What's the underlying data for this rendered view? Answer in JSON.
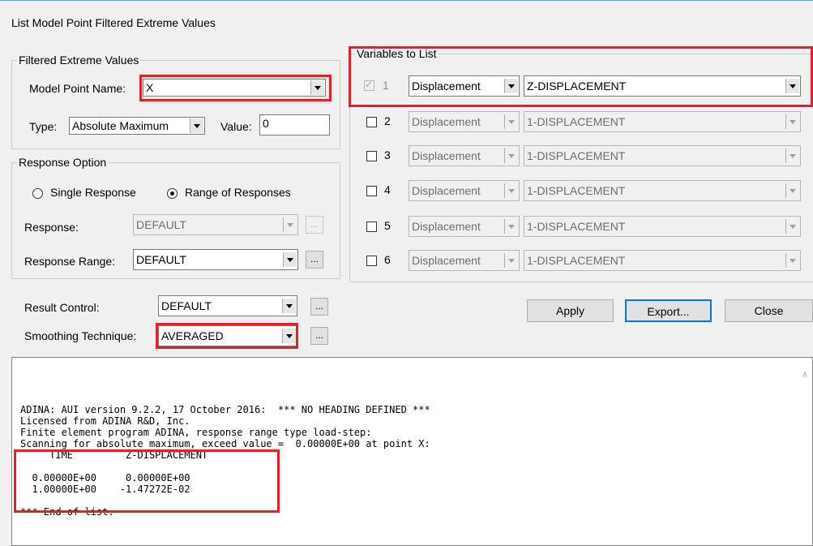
{
  "window": {
    "title": "List Model Point Filtered Extreme Values"
  },
  "filtered": {
    "group_label": "Filtered Extreme Values",
    "model_point_label": "Model Point Name:",
    "model_point_value": "X",
    "type_label": "Type:",
    "type_value": "Absolute Maximum",
    "value_label": "Value:",
    "value_value": "0"
  },
  "response": {
    "group_label": "Response Option",
    "single_label": "Single Response",
    "range_label": "Range of Responses",
    "selected": "Range of Responses",
    "response_label": "Response:",
    "response_value": "DEFAULT",
    "range_field_label": "Response Range:",
    "range_value": "DEFAULT"
  },
  "controls": {
    "result_label": "Result Control:",
    "result_value": "DEFAULT",
    "smoothing_label": "Smoothing Technique:",
    "smoothing_value": "AVERAGED",
    "ellipsis": "..."
  },
  "variables": {
    "group_label": "Variables to List",
    "rows": [
      {
        "num": "1",
        "checked": true,
        "enabled": false,
        "type": "Displacement",
        "variable": "Z-DISPLACEMENT"
      },
      {
        "num": "2",
        "checked": false,
        "enabled": true,
        "type": "Displacement",
        "variable": "1-DISPLACEMENT"
      },
      {
        "num": "3",
        "checked": false,
        "enabled": true,
        "type": "Displacement",
        "variable": "1-DISPLACEMENT"
      },
      {
        "num": "4",
        "checked": false,
        "enabled": true,
        "type": "Displacement",
        "variable": "1-DISPLACEMENT"
      },
      {
        "num": "5",
        "checked": false,
        "enabled": true,
        "type": "Displacement",
        "variable": "1-DISPLACEMENT"
      },
      {
        "num": "6",
        "checked": false,
        "enabled": true,
        "type": "Displacement",
        "variable": "1-DISPLACEMENT"
      }
    ]
  },
  "buttons": {
    "apply": "Apply",
    "export": "Export...",
    "close": "Close"
  },
  "output": {
    "lines": [
      "ADINA: AUI version 9.2.2, 17 October 2016:  *** NO HEADING DEFINED ***",
      "Licensed from ADINA R&D, Inc.",
      "Finite element program ADINA, response range type load-step:",
      "Scanning for absolute maximum, exceed value =  0.00000E+00 at point X:",
      "     TIME         Z-DISPLACEMENT",
      "",
      "  0.00000E+00     0.00000E+00",
      "  1.00000E+00    -1.47272E-02",
      "",
      "*** End of list."
    ]
  },
  "colors": {
    "highlight": "#e0212a",
    "background": "#f0f0f0"
  }
}
